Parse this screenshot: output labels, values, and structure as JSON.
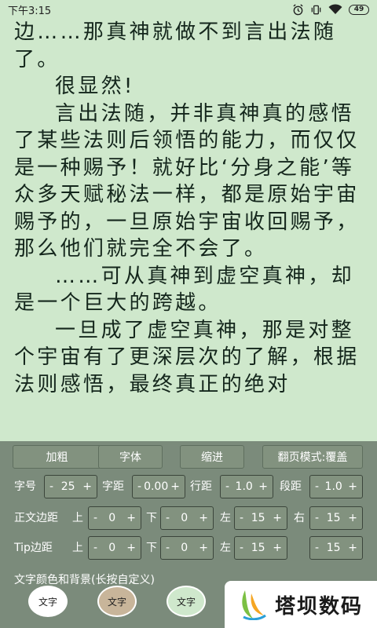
{
  "status_bar": {
    "time": "下午3:15",
    "battery": "49"
  },
  "reader": {
    "paragraphs": [
      {
        "text": "边……那真神就做不到言出法随了。",
        "indent": false
      },
      {
        "text": "很显然!",
        "indent": true
      },
      {
        "text": "言出法随，并非真神真的感悟了某些法则后领悟的能力，而仅仅是一种赐予！就好比‘分身之能’等众多天赋秘法一样，都是原始宇宙赐予的，一旦原始宇宙收回赐予，那么他们就完全不会了。",
        "indent": true
      },
      {
        "text": "……可从真神到虚空真神，却是一个巨大的跨越。",
        "indent": true
      },
      {
        "text": "一旦成了虚空真神，那是对整个宇宙有了更深层次的了解，根据法则感悟，最终真正的绝对",
        "indent": true
      }
    ]
  },
  "toolbar": {
    "bold": "加粗",
    "font": "字体",
    "indent": "缩进",
    "page_mode": "翻页模式:覆盖"
  },
  "spacing": {
    "font_size_label": "字号",
    "font_size": "25",
    "char_spacing_label": "字距",
    "char_spacing": "0.00",
    "line_spacing_label": "行距",
    "line_spacing": "1.0",
    "para_spacing_label": "段距",
    "para_spacing": "1.0"
  },
  "margins": {
    "label": "正文边距",
    "top_label": "上",
    "top": "0",
    "bottom_label": "下",
    "bottom": "0",
    "left_label": "左",
    "left": "15",
    "right_label": "右",
    "right": "15"
  },
  "tip_margins": {
    "label": "Tip边距",
    "top_label": "上",
    "top": "0",
    "bottom_label": "下",
    "bottom": "0",
    "left_label": "左",
    "left": "15"
  },
  "stepper_signs": {
    "minus": "-",
    "plus": "+"
  },
  "colors_section": {
    "title": "文字颜色和背景(长按自定义)",
    "swatches": [
      {
        "label": "文字",
        "bg": "#ffffff"
      },
      {
        "label": "文字",
        "bg": "#c8b59a"
      },
      {
        "label": "文字",
        "bg": "#cfe8cc"
      }
    ]
  },
  "watermark": {
    "text": "塔坝数码"
  }
}
